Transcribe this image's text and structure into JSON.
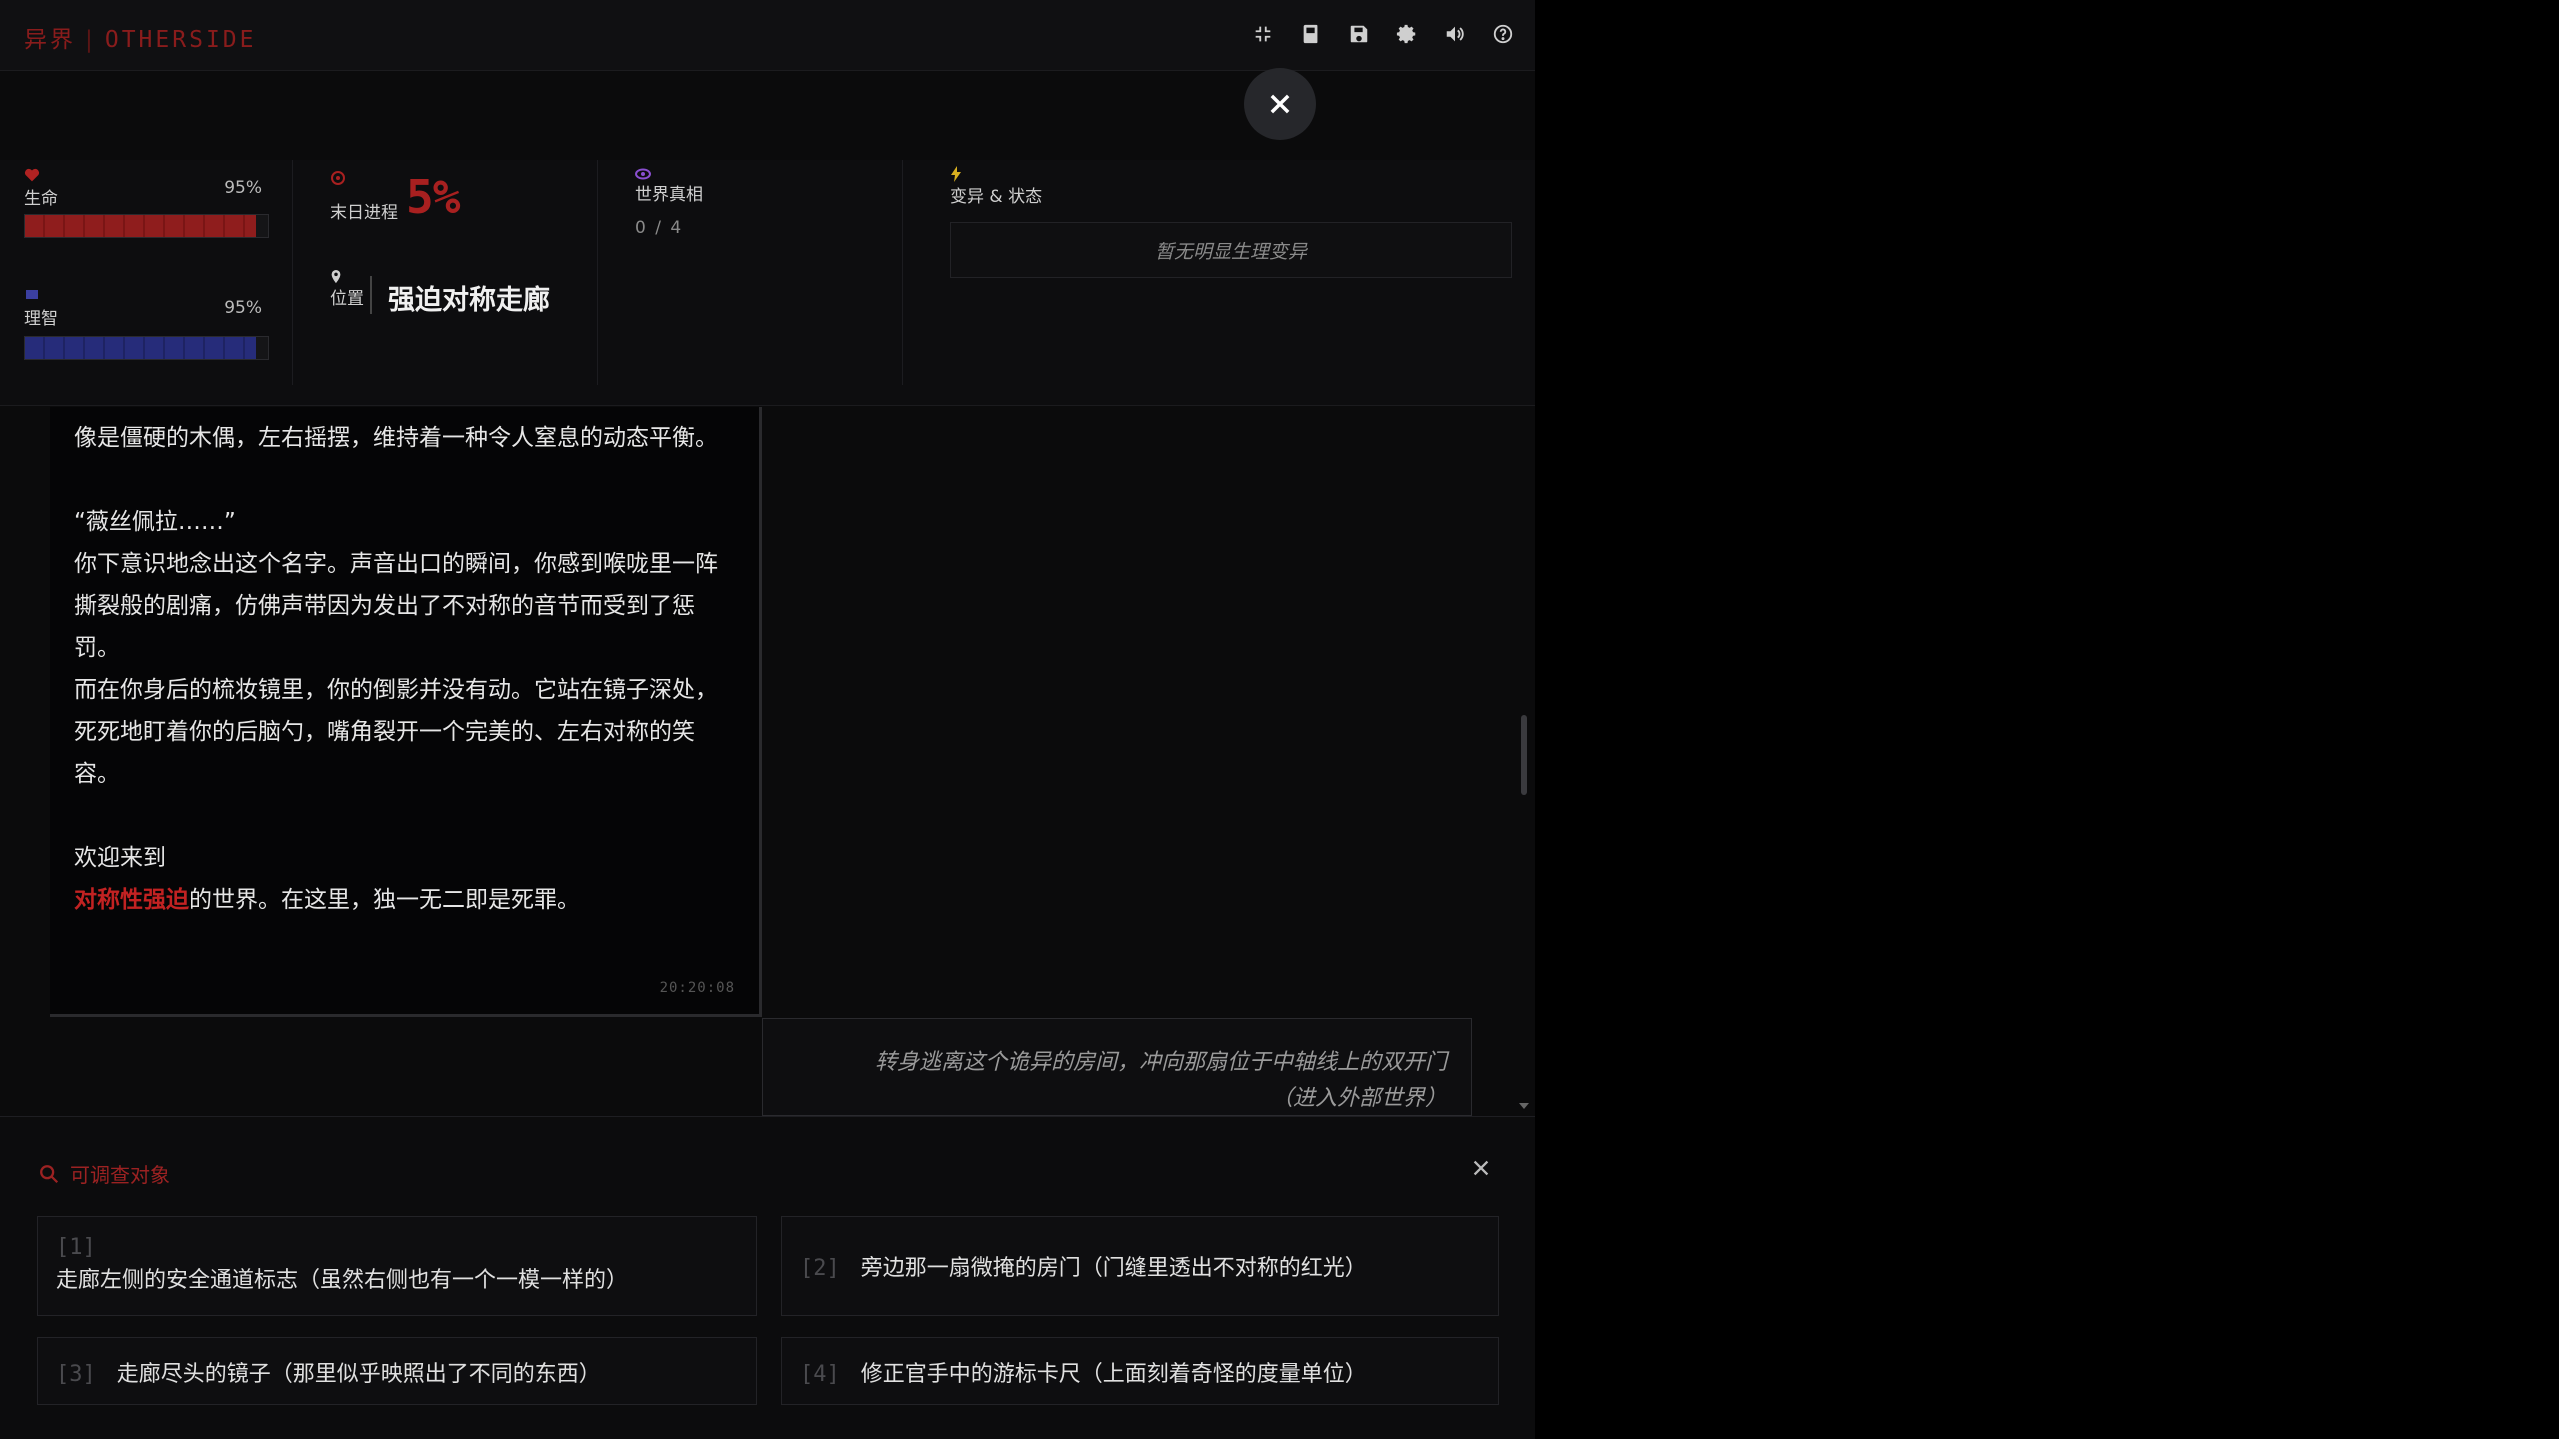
{
  "app": {
    "title_cn": "异界",
    "title_en": "OTHERSIDE"
  },
  "stats": {
    "life": {
      "label": "生命",
      "percent_text": "95%",
      "value": 0.95
    },
    "sanity": {
      "label": "理智",
      "percent_text": "95%",
      "value": 0.95
    },
    "doom": {
      "label": "末日进程",
      "percent_text": "5%"
    },
    "location": {
      "label": "位置",
      "value": "强迫对称走廊"
    },
    "truth": {
      "label": "世界真相",
      "progress": "0 / 4"
    },
    "mutation": {
      "label": "变异 & 状态",
      "empty_text": "暂无明显生理变异"
    }
  },
  "narrative": {
    "lines": [
      "像是僵硬的木偶，左右摇摆，维持着一种令人窒息的动态平衡。",
      "“薇丝佩拉……”",
      "你下意识地念出这个名字。声音出口的瞬间，你感到喉咙里一阵撕裂般的剧痛，仿佛声带因为发出了不对称的音节而受到了惩罚。",
      "而在你身后的梳妆镜里，你的倒影并没有动。它站在镜子深处，死死地盯着你的后脑勺，嘴角裂开一个完美的、左右对称的笑容。",
      "欢迎来到"
    ],
    "highlight": "对称性强迫",
    "final_suffix": "的世界。在这里，独一无二即是死罪。",
    "timestamp": "20:20:08"
  },
  "player_choice": {
    "line1": "转身逃离这个诡异的房间，冲向那扇位于中轴线上的双开门",
    "line2": "（进入外部世界）"
  },
  "investigate": {
    "title": "可调查对象",
    "options": [
      {
        "num": "[1]",
        "text": "走廊左侧的安全通道标志（虽然右侧也有一个一模一样的）"
      },
      {
        "num": "[2]",
        "text": "旁边那一扇微掩的房门（门缝里透出不对称的红光）"
      },
      {
        "num": "[3]",
        "text": "走廊尽头的镜子（那里似乎映照出了不同的东西）"
      },
      {
        "num": "[4]",
        "text": "修正官手中的游标卡尺（上面刻着奇怪的度量单位）"
      }
    ]
  },
  "toolbar": {
    "icons": [
      "collapse-icon",
      "book-icon",
      "save-icon",
      "gear-icon",
      "volume-icon",
      "help-icon"
    ]
  },
  "colors": {
    "accent_red": "#a82020",
    "life_bar": "#8f1d1d",
    "sanity_bar": "#262c7a",
    "bg": "#0b0b0c"
  }
}
